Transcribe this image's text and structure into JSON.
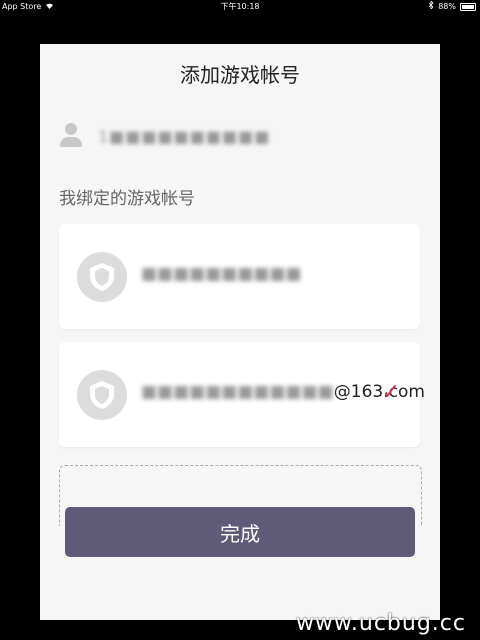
{
  "status_bar": {
    "carrier": "App Store",
    "wifi_icon": "wifi-icon",
    "time": "下午10:18",
    "bluetooth_icon": "bluetooth-icon",
    "battery_percent": "88%",
    "battery_level": 0.88
  },
  "sheet": {
    "title": "添加游戏帐号",
    "current_user": {
      "icon": "user-icon",
      "masked_id": "1■■■■■■■■■■"
    },
    "section_label": "我绑定的游戏帐号",
    "accounts": [
      {
        "icon": "shield-icon",
        "masked": "■■■■■■■■■■",
        "suffix": "",
        "selected": false
      },
      {
        "icon": "shield-icon",
        "masked": "■■■■■■■■■■■■",
        "suffix": "@163.com",
        "selected": true,
        "check_mark": "✓"
      }
    ],
    "done_label": "完成"
  },
  "watermark": "www.ucbug.cc",
  "colors": {
    "button": "#5e5a78",
    "check": "#d6334c",
    "sheet_bg": "#f6f6f6"
  }
}
